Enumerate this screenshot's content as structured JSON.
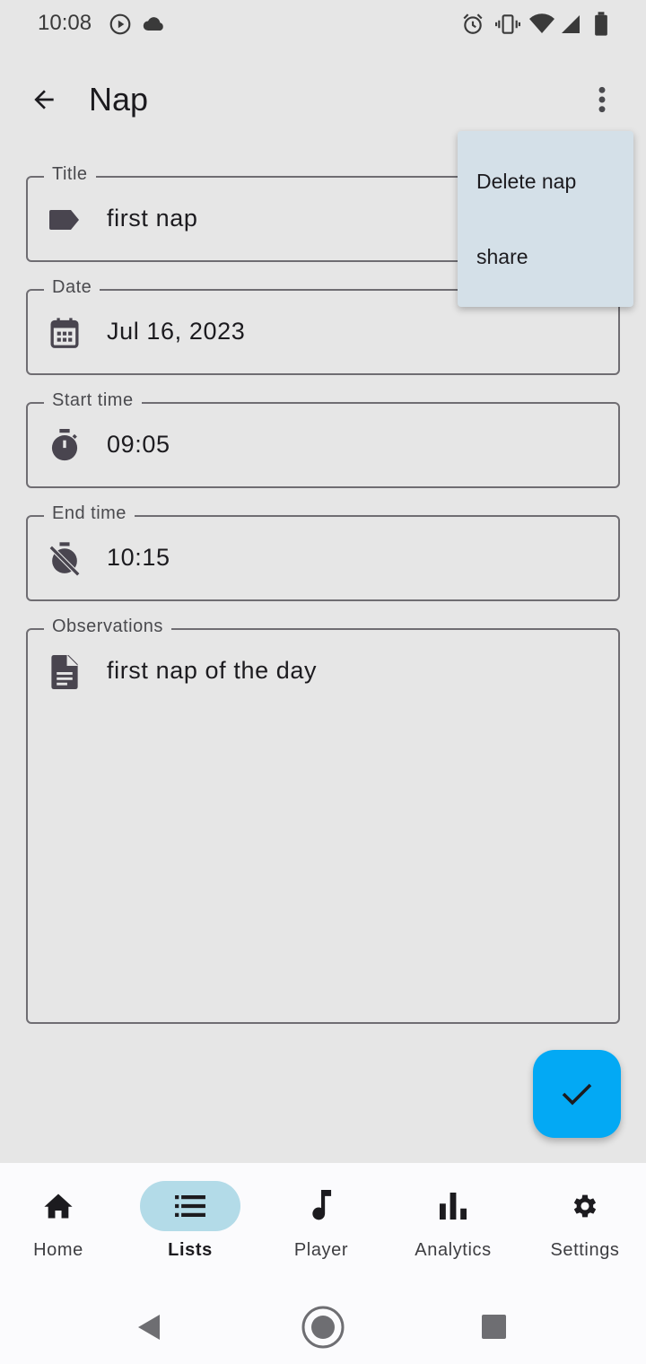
{
  "status_bar": {
    "time": "10:08",
    "left_icons": [
      "play-circle-icon",
      "cloud-icon"
    ],
    "right_icons": [
      "alarm-icon",
      "vibrate-icon",
      "wifi-icon",
      "signal-icon",
      "battery-icon"
    ]
  },
  "app_bar": {
    "title": "Nap",
    "back_icon": "arrow-back-icon",
    "more_icon": "more-vert-icon"
  },
  "fields": {
    "title": {
      "label": "Title",
      "value": "first nap",
      "icon": "label-icon"
    },
    "date": {
      "label": "Date",
      "value": "Jul 16, 2023",
      "icon": "calendar-icon"
    },
    "start_time": {
      "label": "Start time",
      "value": "09:05",
      "icon": "timer-icon"
    },
    "end_time": {
      "label": "End time",
      "value": "10:15",
      "icon": "timer-off-icon"
    },
    "observations": {
      "label": "Observations",
      "value": "first nap of the day",
      "icon": "document-icon"
    }
  },
  "menu": {
    "items": [
      {
        "label": "Delete nap"
      },
      {
        "label": "share"
      }
    ]
  },
  "fab": {
    "icon": "check-icon",
    "color": "#03a9f4"
  },
  "bottom_nav": {
    "active": "Lists",
    "items": [
      {
        "label": "Home",
        "icon": "home-icon"
      },
      {
        "label": "Lists",
        "icon": "list-icon"
      },
      {
        "label": "Player",
        "icon": "music-note-icon"
      },
      {
        "label": "Analytics",
        "icon": "bar-chart-icon"
      },
      {
        "label": "Settings",
        "icon": "gear-icon"
      }
    ]
  },
  "colors": {
    "background": "#e6e6e6",
    "menu_background": "#d4e0e8",
    "active_nav_pill": "#b3dbe8",
    "accent": "#03a9f4"
  }
}
